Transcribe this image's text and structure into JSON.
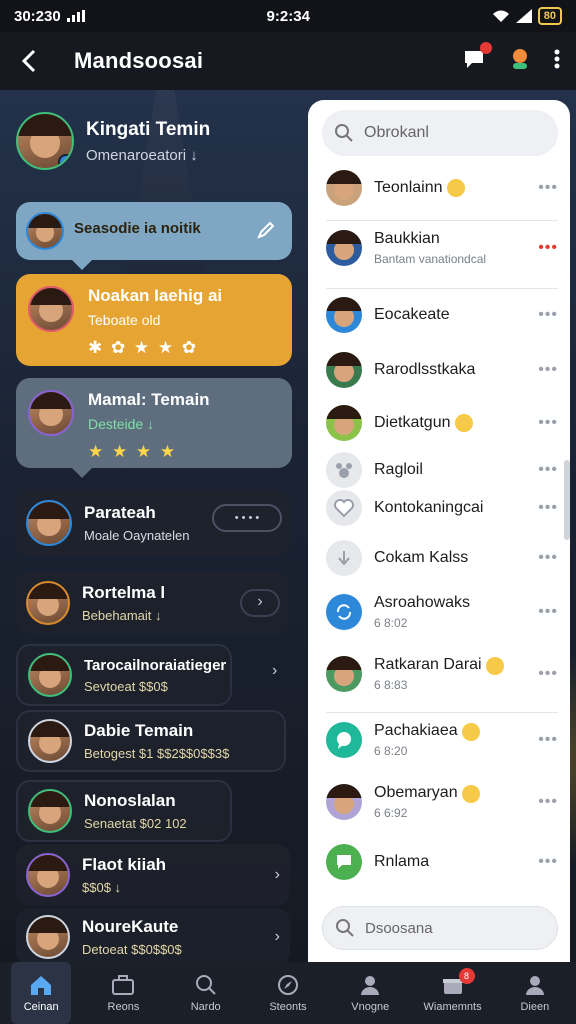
{
  "status_bar": {
    "left": "30:230",
    "center": "9:2:34",
    "battery": "80"
  },
  "app_bar": {
    "title": "Mandsoosai"
  },
  "header_profile": {
    "name": "Kingati Temin",
    "status": "Omenaroeatori ↓"
  },
  "bubbles": [
    {
      "name": "Seasodie ia noitik",
      "status": ""
    },
    {
      "name": "Noakan Iaehig ai",
      "status": "Teboate old",
      "rating": "✱ ✿ ★ ★ ✿"
    },
    {
      "name": "Mamal: Temain",
      "status": "Desteide ↓",
      "rating": "★ ★ ★ ★"
    }
  ],
  "chats": [
    {
      "name": "Parateah",
      "status": "Moale Oaynatelen",
      "action": "• • • •"
    },
    {
      "name": "Rortelma l",
      "status": "Bebehamait ↓"
    },
    {
      "name": "Tarocailnoraiatieger",
      "status": "Sevtoeat $$0$"
    },
    {
      "name": "Dabie Temain",
      "status": "Betogest $1 $$2$$0$$3$"
    },
    {
      "name": "Nonoslalan",
      "status": "Senaetat $02 102"
    },
    {
      "name": "Flaot kiiah",
      "status": "$$0$ ↓"
    },
    {
      "name": "NoureKaute",
      "status": "Detoeat $$0$$0$"
    }
  ],
  "panel": {
    "search_placeholder": "Obrokanl",
    "bottom_search_placeholder": "Dsoosana",
    "contacts": [
      {
        "name": "Teonlainn",
        "sub": ""
      },
      {
        "name": "Baukkian",
        "sub": "Bantam vanationdcal"
      },
      {
        "name": "Eocakeate",
        "sub": ""
      },
      {
        "name": "Rarodlsstkaka",
        "sub": ""
      },
      {
        "name": "Dietkatgun",
        "sub": ""
      },
      {
        "name": "Ragloil",
        "sub": ""
      },
      {
        "name": "Kontokaningcai",
        "sub": ""
      },
      {
        "name": "Cokam Kalss",
        "sub": ""
      },
      {
        "name": "Asroahowaks",
        "sub": "6 8:02"
      },
      {
        "name": "Ratkaran Darai",
        "sub": "6 8:83"
      },
      {
        "name": "Pachakiaea",
        "sub": "6 8:20"
      },
      {
        "name": "Obemaryan",
        "sub": "6 6:92"
      },
      {
        "name": "Rnlama",
        "sub": ""
      }
    ]
  },
  "bottom_nav": [
    {
      "label": "Ceinan"
    },
    {
      "label": "Reons"
    },
    {
      "label": "Nardo"
    },
    {
      "label": "Steonts"
    },
    {
      "label": "Vnogne"
    },
    {
      "label": "Wiamemnts",
      "badge": "8"
    },
    {
      "label": "Dieen"
    }
  ],
  "colors": {
    "accent_green": "#3ec07a",
    "bubble_blue": "#7fa7c4",
    "bubble_gold": "#e6a532",
    "bubble_gray": "#5e6e7f",
    "badge_red": "#e53935"
  }
}
